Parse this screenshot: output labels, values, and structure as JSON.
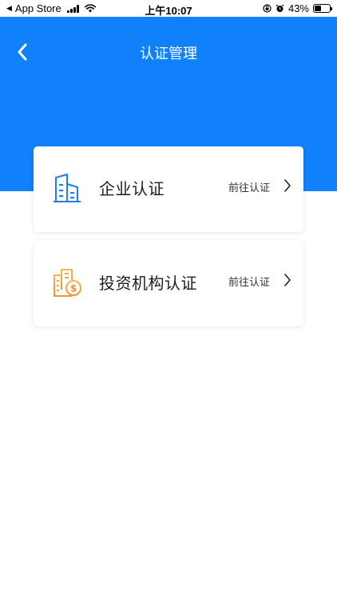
{
  "status_bar": {
    "back_app": "App Store",
    "time": "上午10:07",
    "battery": "43%",
    "battery_level": 0.43
  },
  "header": {
    "title": "认证管理"
  },
  "cards": [
    {
      "title": "企业认证",
      "action": "前往认证",
      "icon": "building-icon"
    },
    {
      "title": "投资机构认证",
      "action": "前往认证",
      "icon": "investment-icon"
    }
  ],
  "colors": {
    "primary": "#1180fb",
    "icon_blue": "#1e7fe8",
    "icon_orange": "#f5a623"
  }
}
